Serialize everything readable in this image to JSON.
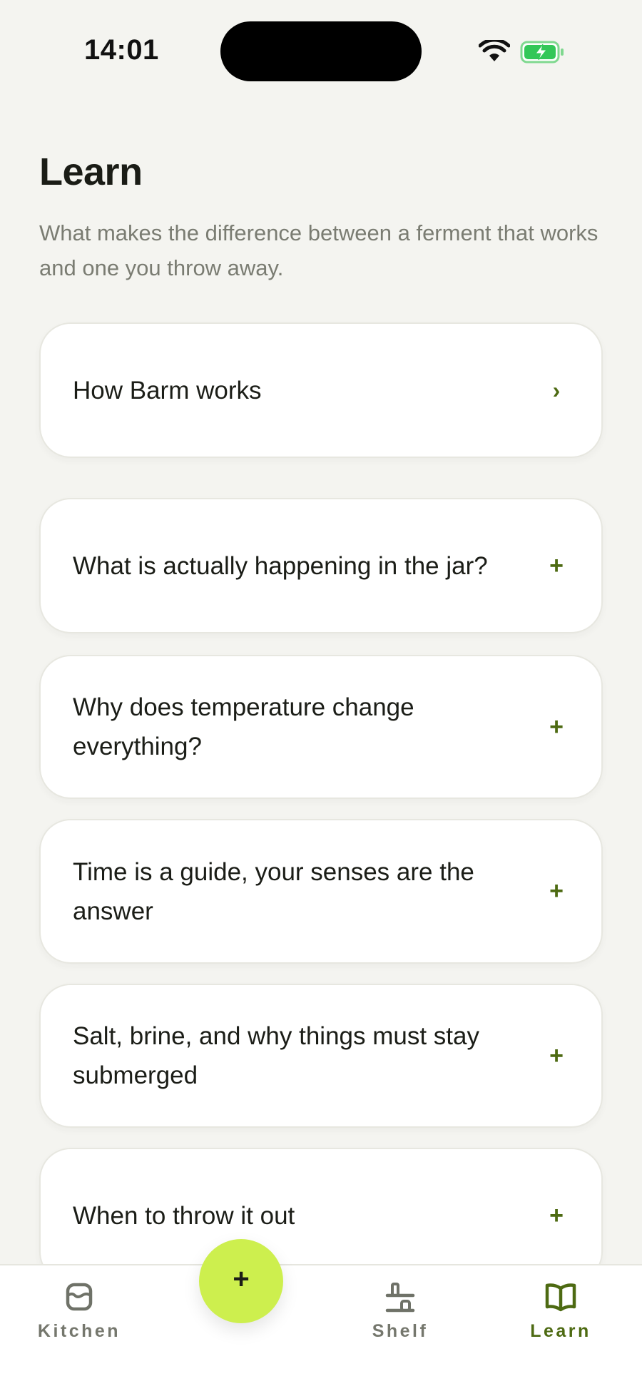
{
  "status_bar": {
    "time": "14:01",
    "wifi_icon": "wifi-icon",
    "battery_icon": "battery-charging-icon",
    "battery_color": "#33c758"
  },
  "header": {
    "title": "Learn",
    "subtitle": "What makes the difference between a ferment that works and one you throw away."
  },
  "cards": [
    {
      "label": "How Barm works",
      "action": "›",
      "action_icon": "chevron-right-icon"
    },
    {
      "label": "What is actually happening in the jar?",
      "action": "+",
      "action_icon": "plus-icon"
    },
    {
      "label": "Why does temperature change everything?",
      "action": "+",
      "action_icon": "plus-icon"
    },
    {
      "label": "Time is a guide, your senses are the answer",
      "action": "+",
      "action_icon": "plus-icon"
    },
    {
      "label": "Salt, brine, and why things must stay submerged",
      "action": "+",
      "action_icon": "plus-icon"
    },
    {
      "label": "When to throw it out",
      "action": "+",
      "action_icon": "plus-icon"
    }
  ],
  "tabbar": {
    "tabs": [
      {
        "label": "Kitchen",
        "icon": "kitchen-jar-icon",
        "active": false
      },
      {
        "label": "Shelf",
        "icon": "shelf-icon",
        "active": false
      },
      {
        "label": "Learn",
        "icon": "open-book-icon",
        "active": true
      }
    ],
    "fab_label": "+",
    "fab_icon": "plus-icon"
  },
  "colors": {
    "background": "#f4f4f0",
    "accent": "#4d6a12",
    "fab": "#cdef4e",
    "muted_text": "#7a7c72"
  }
}
